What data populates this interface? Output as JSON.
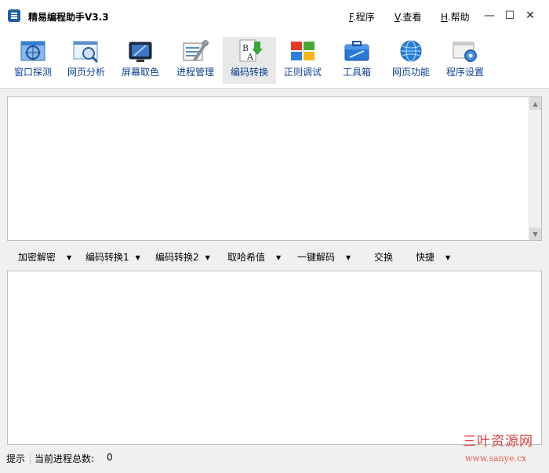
{
  "window": {
    "title": "精易编程助手V3.3",
    "menus": [
      {
        "key": "F",
        "label": ".程序"
      },
      {
        "key": "V",
        "label": ".查看"
      },
      {
        "key": "H",
        "label": ".帮助"
      }
    ],
    "controls": {
      "minimize": "—",
      "maximize": "☐",
      "close": "✕"
    }
  },
  "toolbar": {
    "items": [
      {
        "label": "窗口探测",
        "icon": "window-probe-icon"
      },
      {
        "label": "网页分析",
        "icon": "web-analysis-icon"
      },
      {
        "label": "屏幕取色",
        "icon": "color-picker-icon"
      },
      {
        "label": "进程管理",
        "icon": "process-manager-icon"
      },
      {
        "label": "编码转换",
        "icon": "encoding-convert-icon",
        "active": true
      },
      {
        "label": "正则调试",
        "icon": "regex-debug-icon"
      },
      {
        "label": "工具箱",
        "icon": "toolbox-icon"
      },
      {
        "label": "网页功能",
        "icon": "web-functions-icon"
      },
      {
        "label": "程序设置",
        "icon": "settings-icon"
      }
    ]
  },
  "actions": {
    "encrypt_decrypt": "加密解密",
    "encode_convert_1": "编码转换1",
    "encode_convert_2": "编码转换2",
    "hash_value": "取哈希值",
    "one_click_decode": "一键解码",
    "swap": "交换",
    "shortcuts": "快捷"
  },
  "status": {
    "hint": "提示",
    "process_count_label": "当前进程总数:",
    "process_count": "0"
  },
  "watermark": {
    "cn": "三叶资源网",
    "url": "www.sanye.cx"
  },
  "colors": {
    "toolbar_label": "#0b3f91",
    "watermark": "#d84040"
  }
}
